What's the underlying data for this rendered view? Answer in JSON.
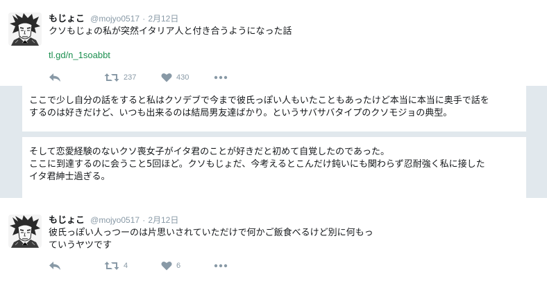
{
  "tweets": [
    {
      "author_name": "もじょこ",
      "handle": "@mojyo0517",
      "separator": "·",
      "date": "2月12日",
      "text": "クソもじょの私が突然イタリア人と付き合うようになった話",
      "link": "tl.gd/n_1soabbt",
      "retweets": "237",
      "likes": "430"
    },
    {
      "author_name": "もじょこ",
      "handle": "@mojyo0517",
      "separator": "·",
      "date": "2月12日",
      "text_line1": "彼氏っぽい人っつーのは片思いされていただけで何かご飯食べるけど別に何もっ",
      "text_line2": "ていうヤツです",
      "retweets": "4",
      "likes": "6"
    }
  ],
  "panels": [
    {
      "line1": "ここで少し自分の話をすると私はクソデブで今まで彼氏っぽい人もいたこともあったけど本当に本当に奥手で話を",
      "line2": "するのは好きだけど、いつも出来るのは結局男友達ばかり。というサバサバタイプのクソモジョの典型。"
    },
    {
      "line1": "そして恋愛経験のないクソ喪女子がイタ君のことが好きだと初めて自覚したのであった。",
      "line2": "ここに到達するのに会うこと5回ほど。クソもじょだ、今考えるとこんだけ鈍いにも関わらず忍耐強く私に接した",
      "line3": "イタ君紳士過ぎる。"
    }
  ],
  "colors": {
    "link": "#1b8f4f",
    "muted": "#8899a6",
    "band": "#e1e8ed"
  },
  "icons": [
    "reply-icon",
    "retweet-icon",
    "like-icon",
    "more-icon",
    "avatar-illustration"
  ]
}
